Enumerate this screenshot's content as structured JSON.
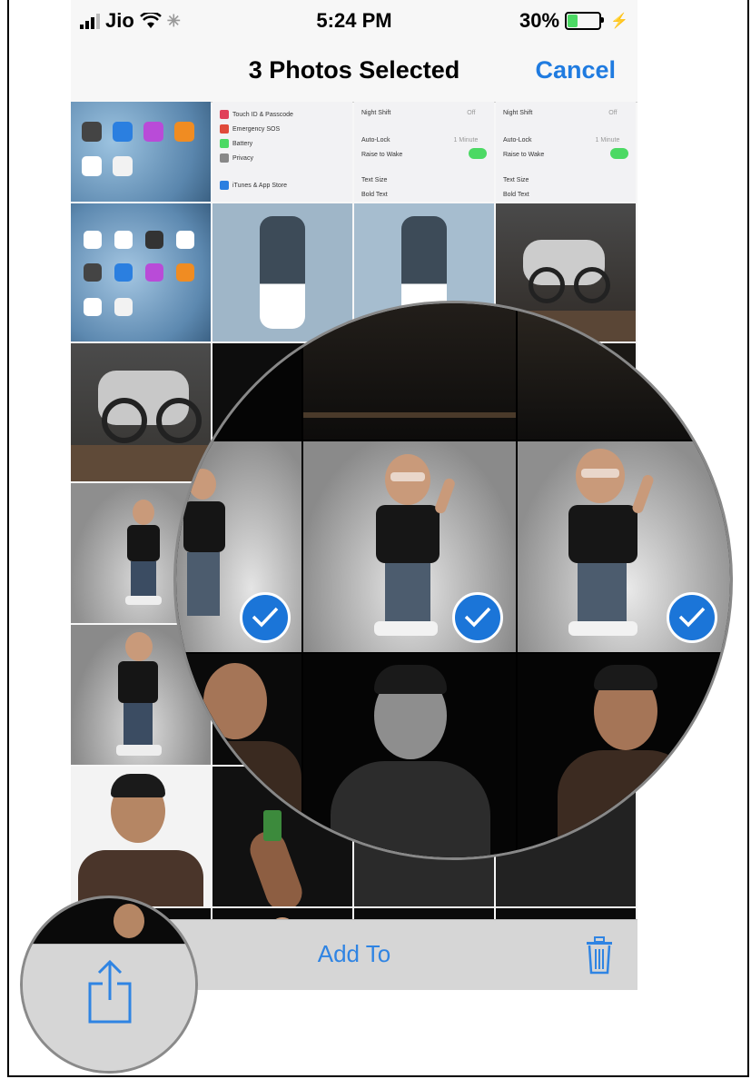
{
  "status_bar": {
    "carrier": "Jio",
    "time": "5:24 PM",
    "battery": "30%",
    "battery_level": 0.3
  },
  "nav": {
    "title": "3 Photos Selected",
    "cancel_label": "Cancel"
  },
  "settings_panel": {
    "items": [
      "Touch ID & Passcode",
      "Emergency SOS",
      "Battery",
      "Privacy",
      "iTunes & App Store"
    ],
    "display_items": [
      "Night Shift",
      "Auto-Lock",
      "Raise to Wake",
      "Text Size",
      "Bold Text"
    ],
    "off_label": "Off",
    "autolock_value": "1 Minute"
  },
  "selection": {
    "selected_count": 3
  },
  "toolbar": {
    "add_to_label": "Add To"
  },
  "icons": [
    "signal-icon",
    "wifi-icon",
    "activity-icon",
    "battery-icon",
    "charging-icon",
    "share-icon",
    "trash-icon",
    "checkmark-icon"
  ],
  "colors": {
    "accent": "#1f7be0",
    "toolbar_bg": "#d6d6d6",
    "check_blue": "#1b75d8",
    "battery_green": "#4cd964"
  }
}
